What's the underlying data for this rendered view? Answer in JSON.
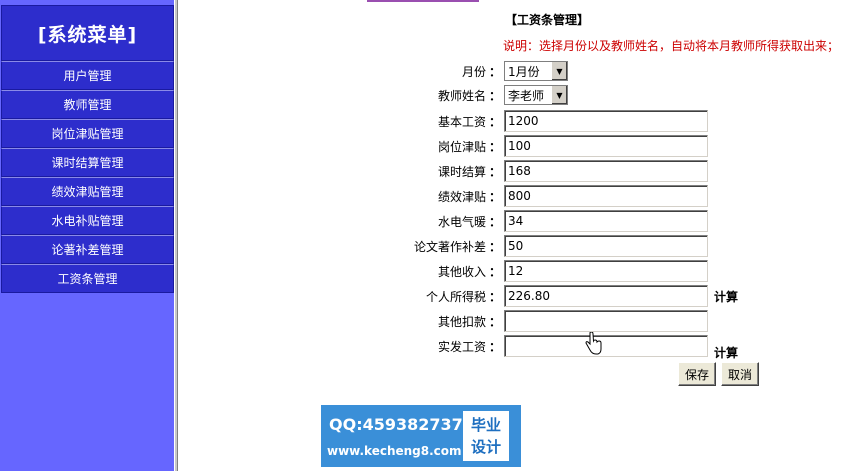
{
  "sidebar": {
    "title": "[系统菜单]",
    "items": [
      {
        "label": "用户管理"
      },
      {
        "label": "教师管理"
      },
      {
        "label": "岗位津贴管理"
      },
      {
        "label": "课时结算管理"
      },
      {
        "label": "绩效津贴管理"
      },
      {
        "label": "水电补贴管理"
      },
      {
        "label": "论著补差管理"
      },
      {
        "label": "工资条管理"
      }
    ]
  },
  "main": {
    "title": "【工资条管理】",
    "note": "说明：选择月份以及教师姓名，自动将本月教师所得获取出来；",
    "colon": "：",
    "month": {
      "label": "月份",
      "value": "1月份"
    },
    "teacher": {
      "label": "教师姓名",
      "value": "李老师"
    },
    "fields": {
      "base_salary": {
        "label": "基本工资",
        "value": "1200"
      },
      "post_allowance": {
        "label": "岗位津贴",
        "value": "100"
      },
      "class_hours": {
        "label": "课时结算",
        "value": "168"
      },
      "performance": {
        "label": "绩效津贴",
        "value": "800"
      },
      "utilities": {
        "label": "水电气暖",
        "value": "34"
      },
      "thesis": {
        "label": "论文著作补差",
        "value": "50"
      },
      "other_income": {
        "label": "其他收入",
        "value": "12"
      },
      "income_tax": {
        "label": "个人所得税",
        "value": "226.80"
      },
      "other_deduction": {
        "label": "其他扣款",
        "value": ""
      },
      "net_salary": {
        "label": "实发工资",
        "value": ""
      }
    },
    "calc_label": "计算",
    "save_label": "保存",
    "cancel_label": "取消"
  },
  "watermark": {
    "qq": "QQ:459382737",
    "url": "www.kecheng8.com",
    "badge_line1": "毕业",
    "badge_line2": "设计"
  },
  "colors": {
    "sidebar_bg": "#6666ff",
    "menu_bg": "#2d2dcc",
    "note_red": "#cc0000",
    "logo_blue": "#3a8fd8"
  }
}
